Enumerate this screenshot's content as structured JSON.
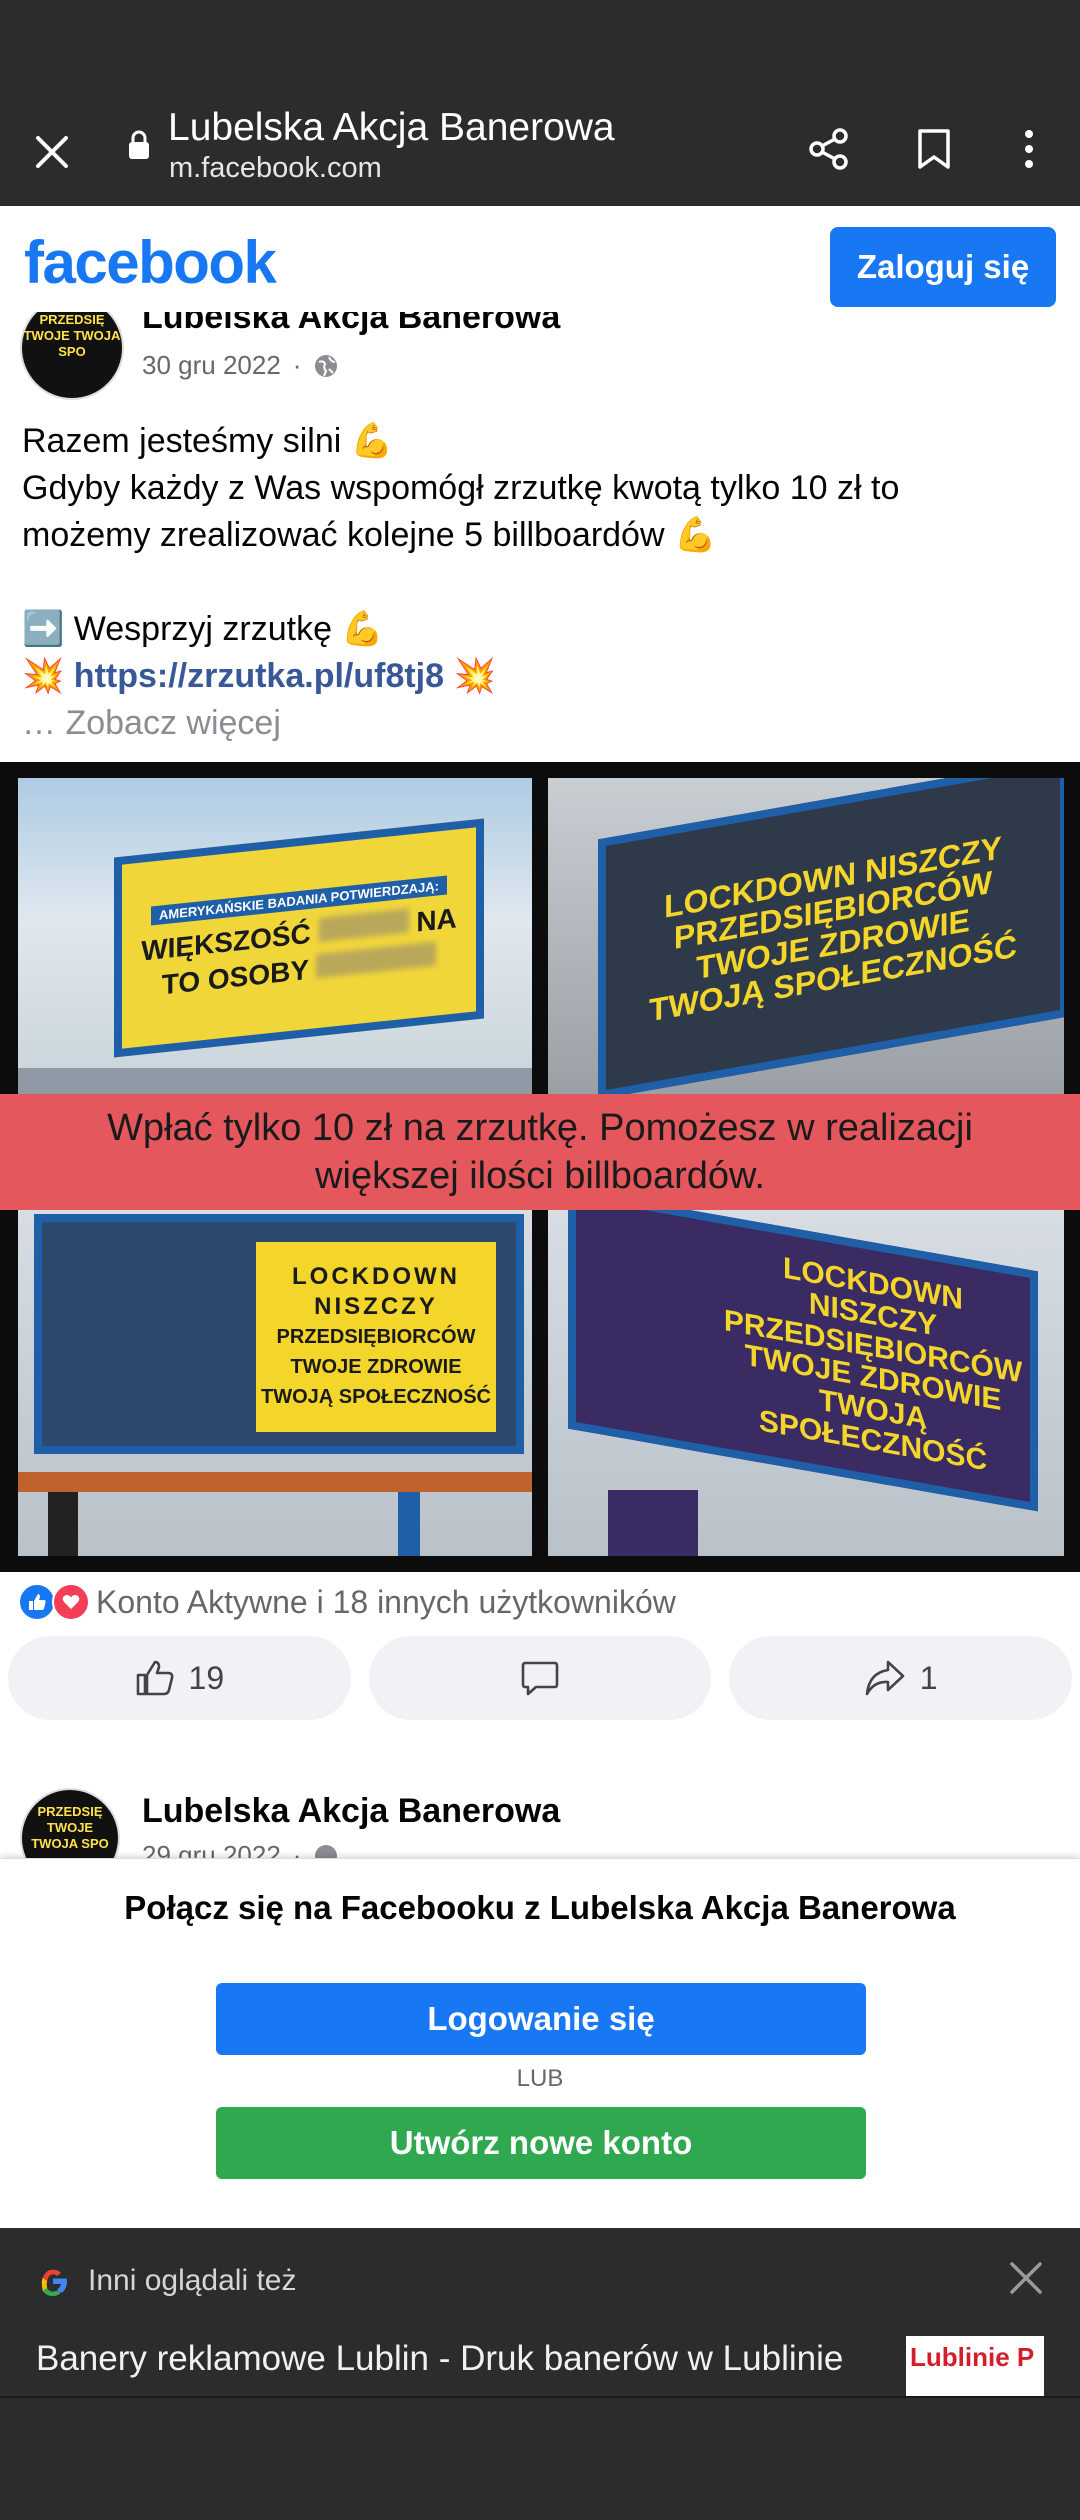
{
  "browser": {
    "title": "Lubelska Akcja Banerowa",
    "url": "m.facebook.com"
  },
  "fb_header": {
    "logo": "facebook",
    "login_label": "Zaloguj się"
  },
  "post": {
    "author": "Lubelska Akcja Banerowa",
    "date": "30 gru 2022",
    "separator": "·",
    "lines": [
      "Razem jesteśmy silni 💪",
      "Gdyby każdy z Was wspomógł zrzutkę kwotą tylko 10 zł to",
      "możemy zrealizować kolejne 5 billboardów 💪",
      "",
      "➡️ Wesprzyj zrzutkę 💪"
    ],
    "link_prefix": "💥",
    "link": "https://zrzutka.pl/uf8tj8",
    "link_suffix": "💥",
    "see_more": "… Zobacz więcej",
    "avatar_text": "PRZEDSIĘ TWOJE TWOJA SPO",
    "image": {
      "banner_line1": "Wpłać tylko 10 zł na zrzutkę. Pomożesz w realizacji",
      "banner_line2": "większej ilości billboardów.",
      "tile1_header": "AMERYKAŃSKIE BADANIA POTWIERDZAJĄ:",
      "tile1_main": "WIĘKSZOŚĆ",
      "tile1_main2": "TO OSOBY",
      "tile1_na": "NA",
      "tile2_text": "LOCKDOWN NISZCZY PRZEDSIĘBIORCÓW TWOJE ZDROWIE TWOJĄ SPOŁECZNOŚĆ",
      "tile3_l1": "LOCKDOWN",
      "tile3_l2": "NISZCZY",
      "tile3_l3": "PRZEDSIĘBIORCÓW",
      "tile3_l4": "TWOJE ZDROWIE",
      "tile3_l5": "TWOJĄ SPOŁECZNOŚĆ",
      "tile4_text": "LOCKDOWN NISZCZY PRZEDSIĘBIORCÓW TWOJE ZDROWIE TWOJĄ SPOŁECZNOŚĆ"
    },
    "reactions_text": "Konto Aktywne i 18 innych użytkowników",
    "like_count": "19",
    "share_count": "1"
  },
  "post2": {
    "author": "Lubelska Akcja Banerowa",
    "date": "29 gru 2022"
  },
  "login_sheet": {
    "title": "Połącz się na Facebooku z Lubelska Akcja Banerowa",
    "login_label": "Logowanie się",
    "or_label": "LUB",
    "create_label": "Utwórz nowe konto"
  },
  "discover": {
    "heading": "Inni oglądali też",
    "item_text": "Banery reklamowe Lublin - Druk banerów w Lublinie",
    "thumb_text": "Lublinie P"
  },
  "colors": {
    "fb_blue": "#1877f2",
    "green": "#2fa84f",
    "banner_red": "#e4575c",
    "chrome": "#2c2c2e"
  }
}
